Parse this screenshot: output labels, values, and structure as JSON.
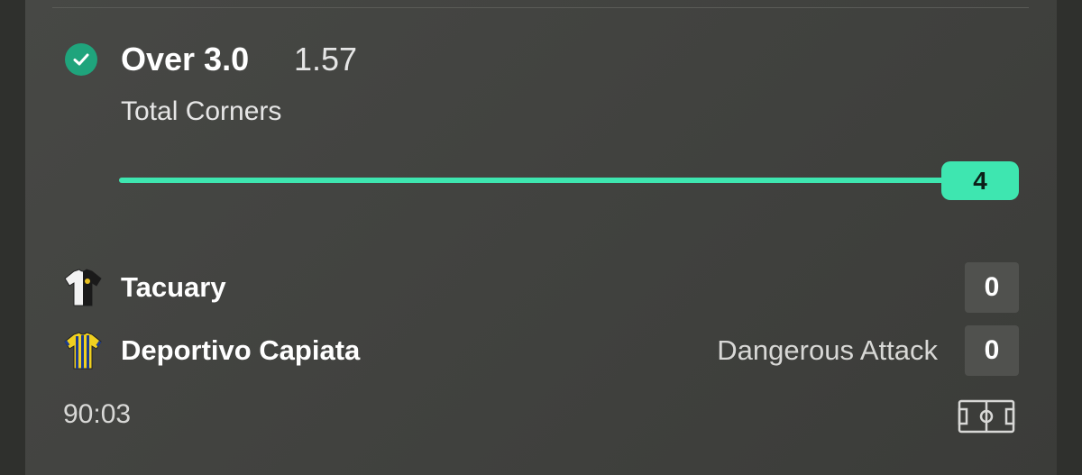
{
  "bet": {
    "status_icon": "check-circle-icon",
    "selection": "Over 3.0",
    "odds": "1.57",
    "market": "Total Corners",
    "progress_value": "4",
    "progress_fraction": 1.0
  },
  "match": {
    "home": {
      "name": "Tacuary",
      "score": "0",
      "jersey_icon": "jersey-icon"
    },
    "away": {
      "name": "Deportivo Capiata",
      "score": "0",
      "jersey_icon": "jersey-icon",
      "event": "Dangerous Attack"
    },
    "time": "90:03",
    "pitch_icon": "pitch-icon"
  },
  "colors": {
    "accent": "#3ee6b0",
    "check": "#1fa47c",
    "background": "#444541"
  }
}
